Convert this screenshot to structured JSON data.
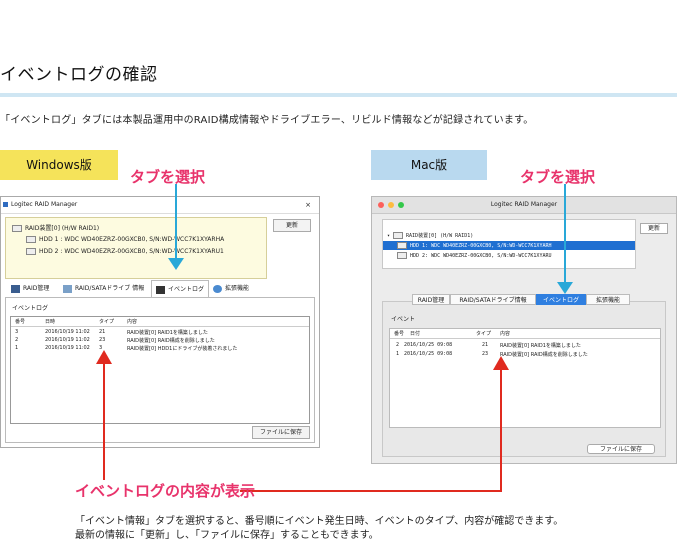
{
  "page": {
    "title": "イベントログの確認",
    "intro": "「イベントログ」タブには本製品運用中のRAID構成情報やドライブエラー、リビルド情報などが記録されています。",
    "windows_tag": "Windows版",
    "mac_tag": "Mac版",
    "callout_tab": "タブを選択",
    "callout_content": "イベントログの内容が表示",
    "footer_line1": "「イベント情報」タブを選択すると、番号順にイベント発生日時、イベントのタイプ、内容が確認できます。",
    "footer_line2": "最新の情報に「更新」し、「ファイルに保存」することもできます。"
  },
  "colors": {
    "accent_pink": "#e8336b",
    "arrow_blue": "#29a8d8",
    "arrow_red": "#e02a1f",
    "windows_tag": "#f5e35a",
    "mac_tag": "#b9d9ef"
  },
  "windows_app": {
    "window_title": "Logitec RAID Manager",
    "close": "×",
    "raid_device": "RAID装置[0]  (H/W RAID1)",
    "hdd1": "HDD 1 :  WDC WD40EZRZ-00GXCB0, S/N:WD-WCC7K1XYARHA",
    "hdd2": "HDD 2 :  WDC WD40EZRZ-00GXCB0, S/N:WD-WCC7K1XYARU1",
    "refresh": "更新",
    "tabs": [
      "RAID管理",
      "RAID/SATAドライブ 情報",
      "イベントログ",
      "拡張機能"
    ],
    "section": "イベントログ",
    "columns": [
      "番号",
      "日時",
      "タイプ",
      "内容"
    ],
    "rows": [
      {
        "no": "3",
        "date": "2016/10/19 11:02",
        "type": "21",
        "content": "RAID装置[0] RAID1を構築しました"
      },
      {
        "no": "2",
        "date": "2016/10/19 11:02",
        "type": "23",
        "content": "RAID装置[0] RAID構成を削除しました"
      },
      {
        "no": "1",
        "date": "2016/10/19 11:02",
        "type": "3",
        "content": "RAID装置[0] HDD1にドライブが装着されました"
      }
    ],
    "save": "ファイルに保存"
  },
  "mac_app": {
    "window_title": "Logitec RAID Manager",
    "raid_device": "RAID装置[0] (H/W RAID1)",
    "hdd1": "HDD 1: WDC WD40EZRZ-00GXCB0, S/N:WD-WCC7K1XYARH",
    "hdd2": "HDD 2: WDC WD40EZRZ-00GXCB0, S/N:WD-WCC7K1XYARU",
    "refresh": "更新",
    "tabs": [
      "RAID管理",
      "RAID/SATAドライブ情報",
      "イベントログ",
      "拡張機能"
    ],
    "section": "イベント",
    "columns": [
      "番号",
      "日付",
      "タイプ",
      "内容"
    ],
    "rows": [
      {
        "no": "2",
        "date": "2016/10/25 09:08",
        "type": "21",
        "content": "RAID装置[0] RAID1を構築しました"
      },
      {
        "no": "1",
        "date": "2016/10/25 09:08",
        "type": "23",
        "content": "RAID装置[0] RAID構成を削除しました"
      }
    ],
    "save": "ファイルに保存"
  }
}
